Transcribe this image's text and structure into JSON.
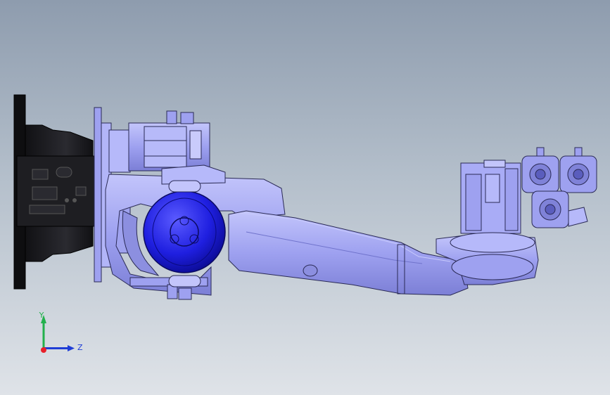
{
  "triad": {
    "y_label": "Y",
    "z_label": "Z",
    "y_color": "#22b14c",
    "z_color": "#1f3dd6",
    "origin_color": "#e8202a"
  },
  "colors": {
    "body": "#a5a8f4",
    "body_shade": "#7f82d8",
    "outline": "#2a2a55",
    "motor_blue": "#1a1ae0",
    "base_black": "#1c1c20"
  }
}
